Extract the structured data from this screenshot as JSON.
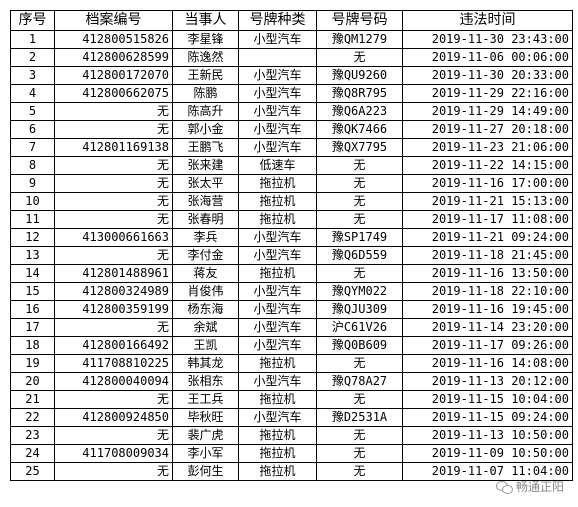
{
  "table": {
    "headers": [
      "序号",
      "档案编号",
      "当事人",
      "号牌种类",
      "号牌号码",
      "违法时间"
    ],
    "rows": [
      [
        "1",
        "412800515826",
        "李星锋",
        "小型汽车",
        "豫QM1279",
        "2019-11-30  23:43:00"
      ],
      [
        "2",
        "412800628599",
        "陈逸然",
        "",
        "无",
        "2019-11-06  00:06:00"
      ],
      [
        "3",
        "412800172070",
        "王新民",
        "小型汽车",
        "豫QU9260",
        "2019-11-30  20:33:00"
      ],
      [
        "4",
        "412800662075",
        "陈鹏",
        "小型汽车",
        "豫Q8R795",
        "2019-11-29  22:16:00"
      ],
      [
        "5",
        "无",
        "陈高升",
        "小型汽车",
        "豫Q6A223",
        "2019-11-29  14:49:00"
      ],
      [
        "6",
        "无",
        "郭小金",
        "小型汽车",
        "豫QK7466",
        "2019-11-27  20:18:00"
      ],
      [
        "7",
        "412801169138",
        "王鹏飞",
        "小型汽车",
        "豫QX7795",
        "2019-11-23  21:06:00"
      ],
      [
        "8",
        "无",
        "张来建",
        "低速车",
        "无",
        "2019-11-22  14:15:00"
      ],
      [
        "9",
        "无",
        "张太平",
        "拖拉机",
        "无",
        "2019-11-16  17:00:00"
      ],
      [
        "10",
        "无",
        "张海营",
        "拖拉机",
        "无",
        "2019-11-21  15:13:00"
      ],
      [
        "11",
        "无",
        "张春明",
        "拖拉机",
        "无",
        "2019-11-17  11:08:00"
      ],
      [
        "12",
        "413000661663",
        "李兵",
        "小型汽车",
        "豫SP1749",
        "2019-11-21  09:24:00"
      ],
      [
        "13",
        "无",
        "李付金",
        "小型汽车",
        "豫Q6D559",
        "2019-11-18  21:45:00"
      ],
      [
        "14",
        "412801488961",
        "蒋友",
        "拖拉机",
        "无",
        "2019-11-16  13:50:00"
      ],
      [
        "15",
        "412800324989",
        "肖俊伟",
        "小型汽车",
        "豫QYM022",
        "2019-11-18  22:10:00"
      ],
      [
        "16",
        "412800359199",
        "杨东海",
        "小型汽车",
        "豫QJU309",
        "2019-11-16  19:45:00"
      ],
      [
        "17",
        "无",
        "余斌",
        "小型汽车",
        "沪C61V26",
        "2019-11-14  23:20:00"
      ],
      [
        "18",
        "412800166492",
        "王凯",
        "小型汽车",
        "豫Q0B609",
        "2019-11-17  09:26:00"
      ],
      [
        "19",
        "411708810225",
        "韩其龙",
        "拖拉机",
        "无",
        "2019-11-16  14:08:00"
      ],
      [
        "20",
        "412800040094",
        "张相东",
        "小型汽车",
        "豫Q78A27",
        "2019-11-13  20:12:00"
      ],
      [
        "21",
        "无",
        "王工兵",
        "拖拉机",
        "无",
        "2019-11-15  10:04:00"
      ],
      [
        "22",
        "412800924850",
        "毕秋旺",
        "小型汽车",
        "豫D2531A",
        "2019-11-15  09:24:00"
      ],
      [
        "23",
        "无",
        "裴广虎",
        "拖拉机",
        "无",
        "2019-11-13  10:50:00"
      ],
      [
        "24",
        "411708009034",
        "李小军",
        "拖拉机",
        "无",
        "2019-11-09  10:50:00"
      ],
      [
        "25",
        "无",
        "彭何生",
        "拖拉机",
        "无",
        "2019-11-07  11:04:00"
      ]
    ]
  },
  "watermark": {
    "icon": "wechat-icon",
    "text": "畅通正阳"
  }
}
